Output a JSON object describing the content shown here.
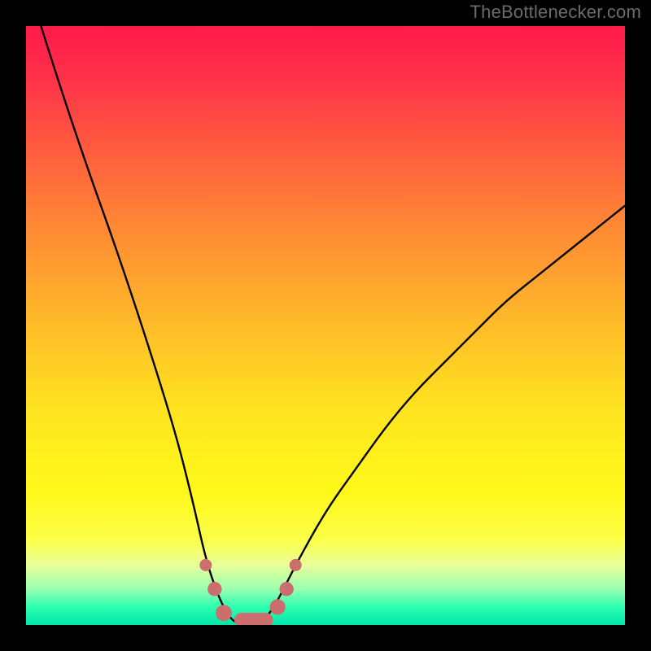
{
  "watermark": "TheBottlenecker.com",
  "gradient_colors": {
    "top": "#ff1a4b",
    "mid_high": "#ff8a34",
    "mid": "#ffe41f",
    "mid_low": "#fcff4a",
    "low": "#00e6a8"
  },
  "chart_data": {
    "type": "line",
    "title": "",
    "xlabel": "",
    "ylabel": "",
    "xlim": [
      0,
      100
    ],
    "ylim": [
      0,
      100
    ],
    "grid": false,
    "legend": false,
    "annotations": [
      "TheBottlenecker.com"
    ],
    "note": "Axes are implicit (no tick labels shown). Curve is a V-shaped bottleneck profile; y≈100 means worst (red), y≈0 means best (green). Minimum region lies roughly at x≈34–41 where y≈0.",
    "series": [
      {
        "name": "bottleneck-curve",
        "x": [
          0,
          5,
          10,
          15,
          20,
          25,
          28,
          30,
          32,
          34,
          36,
          38,
          40,
          42,
          45,
          50,
          55,
          60,
          65,
          70,
          75,
          80,
          85,
          90,
          95,
          100
        ],
        "y": [
          108,
          92,
          77,
          63,
          48,
          32,
          20,
          11,
          5,
          1,
          0,
          0,
          1,
          4,
          10,
          19,
          26,
          33,
          39,
          44,
          49,
          54,
          58,
          62,
          66,
          70
        ]
      },
      {
        "name": "highlight-dots",
        "note": "salmon segments/markers near the valley",
        "x": [
          30,
          31.5,
          33,
          36,
          38,
          40,
          42,
          43.5,
          45
        ],
        "y": [
          10,
          6,
          2,
          0,
          0,
          0,
          3,
          6,
          10
        ]
      }
    ],
    "curve_color": "#000000",
    "highlight_color": "#cc6e6e"
  }
}
